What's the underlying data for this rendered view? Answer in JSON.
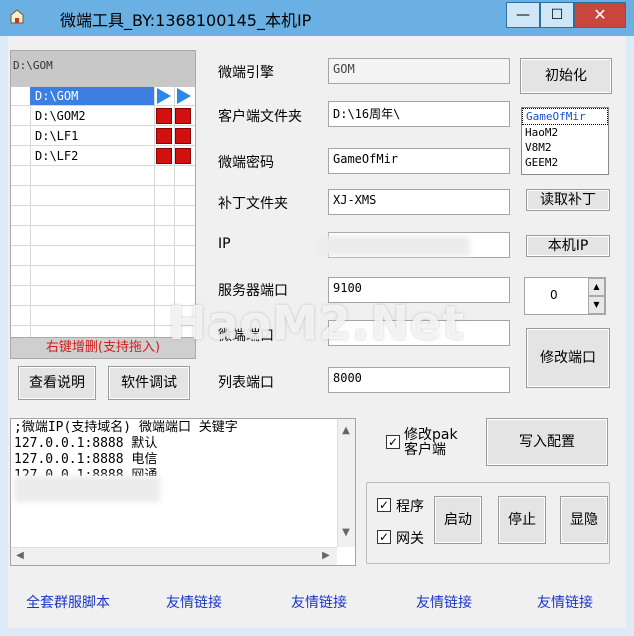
{
  "window": {
    "title": "微端工具_BY:1368100145_本机IP",
    "minimize_glyph": "—",
    "maximize_glyph": "☐",
    "close_glyph": "✕",
    "title_bar_color": "#6ab0e2"
  },
  "path_list": {
    "header": "D:\\GOM",
    "items": [
      {
        "path": "D:\\GOM",
        "selected": true,
        "marker": "play-icon"
      },
      {
        "path": "D:\\GOM2",
        "selected": false,
        "marker": "red-box"
      },
      {
        "path": "D:\\LF1",
        "selected": false,
        "marker": "red-box"
      },
      {
        "path": "D:\\LF2",
        "selected": false,
        "marker": "red-box"
      }
    ],
    "hint": "右键增删(支持拖入)"
  },
  "buttons": {
    "view_help": "查看说明",
    "debug": "软件调试",
    "init": "初始化",
    "read_patch": "读取补丁",
    "local_ip": "本机IP",
    "modify_port": "修改端口",
    "write_config": "写入配置",
    "start": "启动",
    "stop": "停止",
    "show_hide": "显隐"
  },
  "form": {
    "engine_label": "微端引擎",
    "engine_value": "GOM",
    "client_folder_label": "客户端文件夹",
    "client_folder_value": "D:\\16周年\\",
    "password_label": "微端密码",
    "password_value": "GameOfMir",
    "patch_folder_label": "补丁文件夹",
    "patch_folder_value": "XJ-XMS",
    "ip_label": "IP",
    "ip_value": "",
    "server_port_label": "服务器端口",
    "server_port_value": "9100",
    "micro_port_label": "微端端口",
    "micro_port_value": "",
    "list_port_label": "列表端口",
    "list_port_value": "8000",
    "spin_value": "0"
  },
  "engine_list": [
    "GameOfMir",
    "HaoM2",
    "V8M2",
    "GEEM2"
  ],
  "config_text": ";微端IP(支持域名) 微端端口 关键字\n127.0.0.1:8888 默认\n127.0.0.1:8888 电信\n127.0.0.1:8888 网通",
  "checkboxes": {
    "modify_pak": {
      "label": "修改pak\n客户端",
      "checked": true
    },
    "program": {
      "label": "程序",
      "checked": true
    },
    "gateway": {
      "label": "网关",
      "checked": true
    }
  },
  "links": [
    "全套群服脚本",
    "友情链接",
    "友情链接",
    "友情链接",
    "友情链接"
  ],
  "watermark": "HaoM2.Net"
}
